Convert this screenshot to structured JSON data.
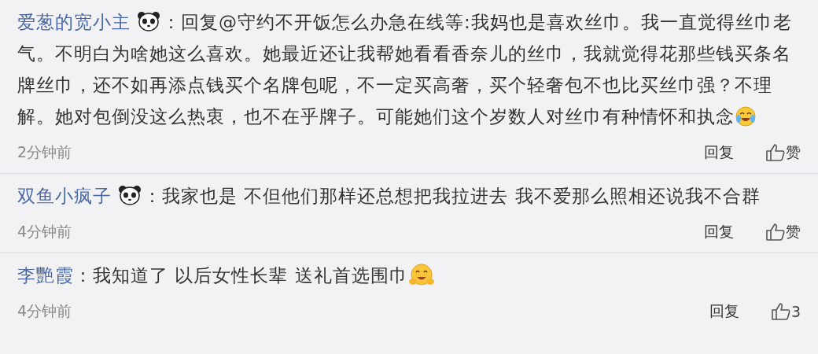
{
  "comments": [
    {
      "author": "爱葱的宽小主",
      "badge": true,
      "separator": "：",
      "mention": "回复@守约不开饭怎么办急在线等",
      "text": ":我妈也是喜欢丝巾。我一直觉得丝巾老气。不明白为啥她这么喜欢。她最近还让我帮她看看香奈儿的丝巾，我就觉得花那些钱买条名牌丝巾，还不如再添点钱买个名牌包呢，不一定买高奢，买个轻奢包不也比买丝巾强？不理解。她对包倒没这么热衷，也不在乎牌子。可能她们这个岁数人对丝巾有种情怀和执念",
      "emoji": {
        "kind": "crying-laugh"
      },
      "time": "2分钟前",
      "reply": "回复",
      "like": "赞"
    },
    {
      "author": "双鱼小疯子",
      "badge": true,
      "separator": "：",
      "text": "我家也是 不但他们那样还总想把我拉进去 我不爱那么照相还说我不合群",
      "time": "4分钟前",
      "reply": "回复",
      "like": "赞"
    },
    {
      "author": "李艷霞",
      "badge": false,
      "separator": "：",
      "text": "我知道了 以后女性长辈 送礼首选围巾",
      "emoji": {
        "kind": "blush"
      },
      "time": "4分钟前",
      "reply": "回复",
      "like": "3"
    }
  ]
}
